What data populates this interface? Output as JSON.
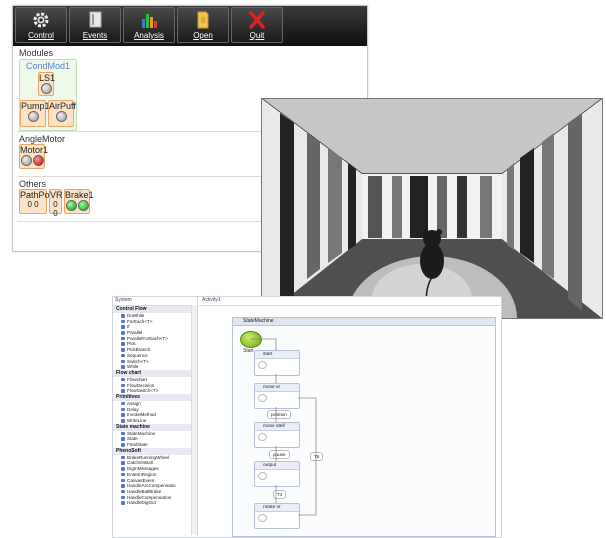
{
  "toolbar": {
    "buttons": [
      {
        "label": "Control",
        "icon": "gear-icon"
      },
      {
        "label": "Events",
        "icon": "document-icon"
      },
      {
        "label": "Analysis",
        "icon": "bar-chart-icon"
      },
      {
        "label": "Open",
        "icon": "folder-icon"
      },
      {
        "label": "Quit",
        "icon": "close-icon"
      }
    ]
  },
  "modules": {
    "title": "Modules",
    "group_title": "CondMod1",
    "ls1": "LS1",
    "pump1": "Pump1",
    "airpuff": "AirPuff"
  },
  "angle_motor": {
    "title": "AngleMotor",
    "motor1": "Motor1"
  },
  "others": {
    "title": "Others",
    "pathpos": "PathPos",
    "pathpos_val": "0 0",
    "vr": "VR",
    "vr_val": "0 0",
    "brake1": "Brake1"
  },
  "workflow": {
    "toolbox_title": "System",
    "tab_title": "Activity1",
    "container_title": "StateMachine",
    "categories": [
      {
        "name": "Control Flow",
        "items": [
          "DoWhile",
          "ForEach<T>",
          "If",
          "Parallel",
          "ParallelForEach<T>",
          "Pick",
          "PickBranch",
          "Sequence",
          "Switch<T>",
          "While"
        ]
      },
      {
        "name": "Flow chart",
        "items": [
          "Flowchart",
          "FlowDecision",
          "FlowSwitch<T>"
        ]
      },
      {
        "name": "Primitives",
        "items": [
          "Assign",
          "Delay",
          "InvokeMethod",
          "WriteLine"
        ]
      },
      {
        "name": "State machine",
        "items": [
          "StateMachine",
          "State",
          "FinalState"
        ]
      },
      {
        "name": "PhenoSoft",
        "items": [
          "BrakeRunningWheel",
          "CatchOnBall",
          "DigInMessages",
          "EnterInRegion",
          "CanvasEvent",
          "HandleArcCompensatio",
          "HandleBallBrake",
          "HandleCompensation",
          "HandleDigOut"
        ]
      }
    ],
    "states": [
      "start",
      "move vr",
      "move stell",
      "output",
      "rotate vr"
    ],
    "transitions": [
      "position",
      "pause",
      "T4",
      "T5"
    ],
    "start_label": "Start"
  },
  "colors": {
    "toolbar_bg": "#1a1a1a",
    "device_bg": "#fce3c6",
    "group_bg": "#eef9ea",
    "led_red": "#c00000",
    "led_green": "#0a9a0a"
  }
}
